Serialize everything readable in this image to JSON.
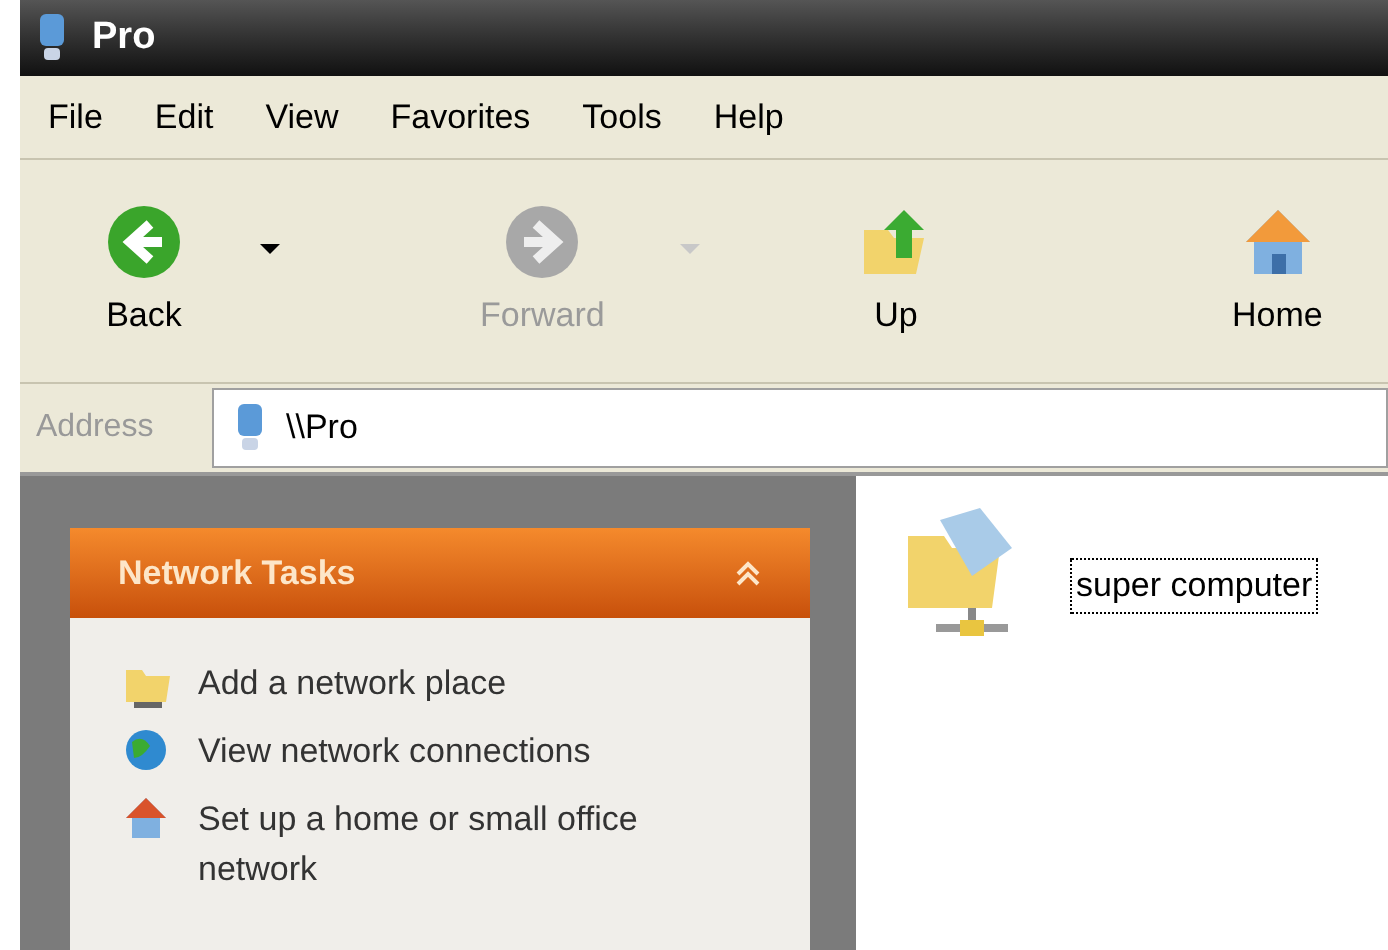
{
  "window": {
    "title": "Pro"
  },
  "menu": [
    "File",
    "Edit",
    "View",
    "Favorites",
    "Tools",
    "Help"
  ],
  "toolbar": [
    {
      "kind": "back",
      "label": "Back",
      "disabled": false,
      "dropdown": true
    },
    {
      "kind": "forward",
      "label": "Forward",
      "disabled": true,
      "dropdown": true
    },
    {
      "kind": "up",
      "label": "Up",
      "disabled": false,
      "dropdown": false
    },
    {
      "kind": "home",
      "label": "Home",
      "disabled": false,
      "dropdown": false
    }
  ],
  "address": {
    "label": "Address",
    "value": "\\\\Pro"
  },
  "task_panel": {
    "title": "Network Tasks",
    "expanded": true,
    "items": [
      {
        "kind": "add-place",
        "label": "Add a network place"
      },
      {
        "kind": "connections",
        "label": "View network connections"
      },
      {
        "kind": "home-network",
        "label": "Set up a home or small office network"
      }
    ]
  },
  "items": [
    {
      "label": "super computer",
      "selected": true
    }
  ]
}
